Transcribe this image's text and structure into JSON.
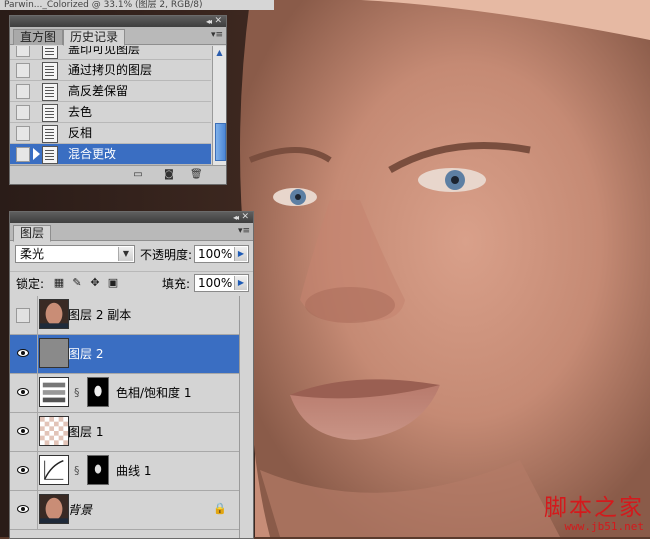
{
  "document": {
    "title": "Parwin..._Colorized @ 33.1% (图层 2, RGB/8)"
  },
  "history_panel": {
    "tabs": [
      {
        "label": "直方图",
        "active": false
      },
      {
        "label": "历史记录",
        "active": true
      }
    ],
    "items": [
      {
        "label": "盖印可见图层",
        "selected": false
      },
      {
        "label": "通过拷贝的图层",
        "selected": false
      },
      {
        "label": "高反差保留",
        "selected": false
      },
      {
        "label": "去色",
        "selected": false
      },
      {
        "label": "反相",
        "selected": false
      },
      {
        "label": "混合更改",
        "selected": true
      }
    ],
    "footer_icons": [
      "new-document-from-state-icon",
      "new-snapshot-icon",
      "delete-state-icon"
    ]
  },
  "layers_panel": {
    "tab_label": "图层",
    "blend_mode": "柔光",
    "opacity_label": "不透明度:",
    "opacity_value": "100%",
    "lock_label": "锁定:",
    "fill_label": "填充:",
    "fill_value": "100%",
    "layers": [
      {
        "name": "图层 2 副本",
        "visible": false,
        "selected": false,
        "thumb": "photo",
        "italic": false
      },
      {
        "name": "图层 2",
        "visible": true,
        "selected": true,
        "thumb": "gray",
        "italic": false
      },
      {
        "name": "色相/饱和度 1",
        "visible": true,
        "selected": false,
        "thumb": "hue-sat-adjustment",
        "mask": true,
        "italic": false
      },
      {
        "name": "图层 1",
        "visible": true,
        "selected": false,
        "thumb": "transparent",
        "italic": false
      },
      {
        "name": "曲线 1",
        "visible": true,
        "selected": false,
        "thumb": "curves-adjustment",
        "mask": true,
        "italic": false
      },
      {
        "name": "背景",
        "visible": true,
        "selected": false,
        "thumb": "photo",
        "locked": true,
        "italic": true
      }
    ]
  },
  "watermark": {
    "text": "脚本之家",
    "url": "www.jb51.net"
  },
  "colors": {
    "selection": "#3a6ec2",
    "panel_bg": "#d4d4d4",
    "watermark": "#d4191c"
  }
}
